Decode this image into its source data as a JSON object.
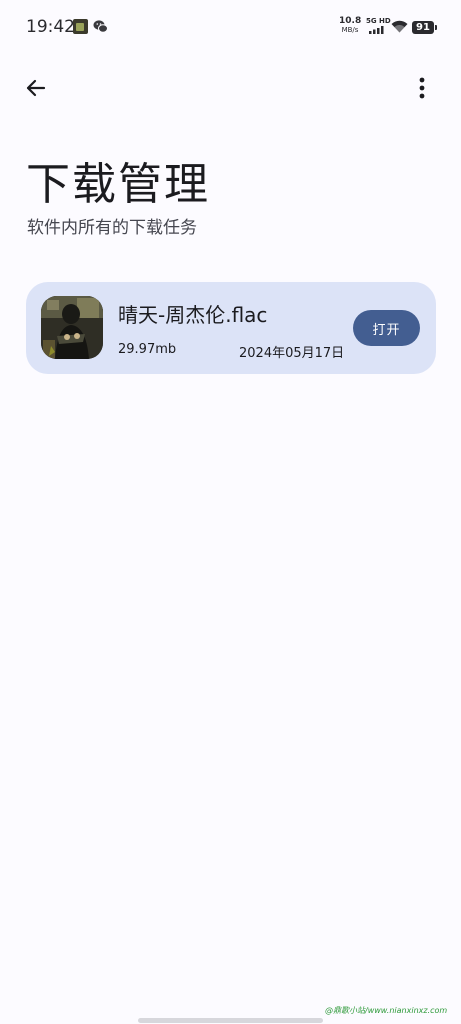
{
  "status_bar": {
    "time": "19:42",
    "net_speed_value": "10.8",
    "net_speed_unit": "MB/s",
    "signal_label": "5G HD",
    "battery_level": "91",
    "notification_icons": [
      "photo-notification-icon",
      "wechat-icon"
    ]
  },
  "app_bar": {
    "back_icon": "arrow-left-icon",
    "menu_icon": "more-vert-icon"
  },
  "page": {
    "title": "下载管理",
    "subtitle": "软件内所有的下载任务"
  },
  "downloads": [
    {
      "file_name": "晴天-周杰伦.flac",
      "size": "29.97mb",
      "date": "2024年05月17日",
      "action_label": "打开",
      "thumbnail_icon": "album-art"
    }
  ],
  "colors": {
    "background": "#fcfbff",
    "card": "#dce3f7",
    "button": "#435e91"
  },
  "watermark": "@鼎歌小站/www.nianxinxz.com"
}
